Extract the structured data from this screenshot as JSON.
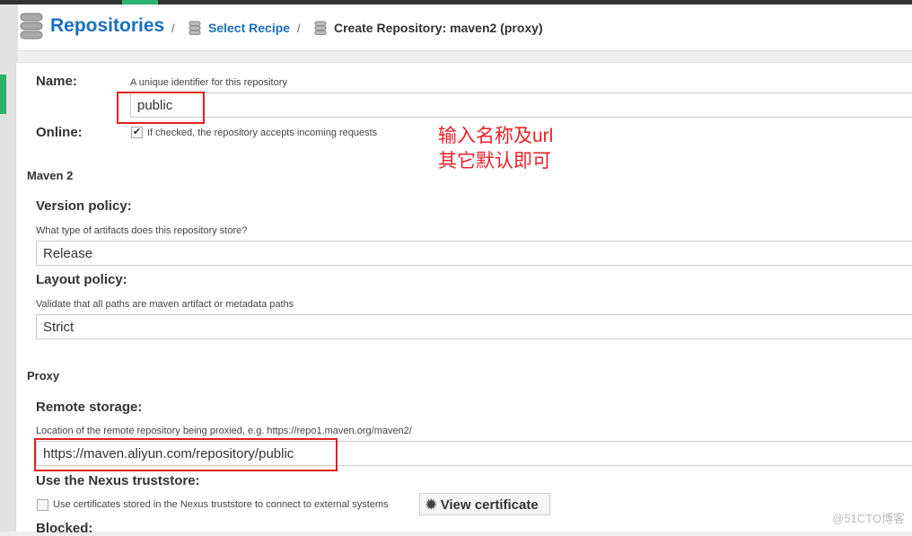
{
  "header": {
    "title": "Repositories",
    "crumb1": "Select Recipe",
    "crumb2": "Create Repository: maven2 (proxy)",
    "sep": "/"
  },
  "form": {
    "name_label": "Name:",
    "name_hint": "A unique identifier for this repository",
    "name_value": "public",
    "online_label": "Online:",
    "online_hint": "If checked, the repository accepts incoming requests",
    "online_checked": true,
    "maven_section": "Maven 2",
    "version_label": "Version policy:",
    "version_hint": "What type of artifacts does this repository store?",
    "version_value": "Release",
    "layout_label": "Layout policy:",
    "layout_hint": "Validate that all paths are maven artifact or metadata paths",
    "layout_value": "Strict",
    "proxy_section": "Proxy",
    "remote_label": "Remote storage:",
    "remote_hint": "Location of the remote repository being proxied, e.g. https://repo1.maven.org/maven2/",
    "remote_value": "https://maven.aliyun.com/repository/public",
    "trust_label": "Use the Nexus truststore:",
    "trust_hint": "Use certificates stored in the Nexus truststore to connect to external systems",
    "trust_checked": false,
    "view_cert": "View certificate",
    "blocked_label": "Blocked:"
  },
  "annotation": {
    "line1": "输入名称及url",
    "line2": "其它默认即可"
  },
  "watermark": "@51CTO博客",
  "colors": {
    "accent": "#1a6fc0",
    "annotation": "#e8232a",
    "nav_green": "#2db36f"
  }
}
